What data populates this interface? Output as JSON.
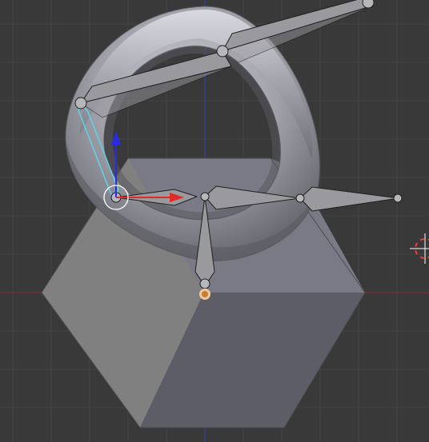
{
  "viewport": {
    "background_color": "#393939",
    "grid_color": "#434343",
    "x_axis_color": "#7a3232",
    "z_axis_color": "#3b3b9c",
    "view_axis": "front",
    "objects": {
      "cube": {
        "top_face_color": "#7a7a86",
        "left_face_color": "#808080",
        "right_face_color": "#5d5d68",
        "edge_color": "#4c4c50"
      },
      "torus": {
        "base_color": "#8e8e96",
        "highlight_color": "#d8d8de",
        "shadow_color": "#5a5a60"
      },
      "armature": {
        "bone_fill_color": "#9a9a9e",
        "bone_outline_color": "#1f1f1f",
        "joint_color": "#b8b8bc",
        "selected_outline_color": "#5fd0e8"
      },
      "origin_marker": {
        "fill_color": "#c77a3a",
        "ring_color": "#f0c89a"
      }
    },
    "manipulator": {
      "x_arrow_color": "#e02a2a",
      "z_arrow_color": "#2a2ae6",
      "ring_color": "#ffffff"
    },
    "cursor_3d": {
      "ring_color_a": "#ffffff",
      "ring_color_b": "#ff3b3b"
    }
  }
}
